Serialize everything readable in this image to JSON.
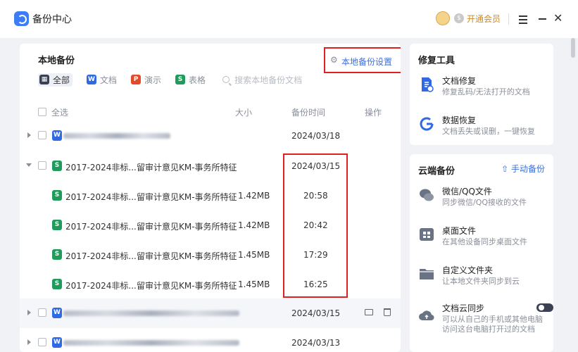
{
  "app": {
    "title": "备份中心",
    "vip_label": "开通会员"
  },
  "left": {
    "title": "本地备份",
    "settings_label": "本地备份设置",
    "filters": [
      {
        "label": "全部",
        "icon": "grid-icon"
      },
      {
        "label": "文档",
        "icon": "W"
      },
      {
        "label": "演示",
        "icon": "P"
      },
      {
        "label": "表格",
        "icon": "S"
      }
    ],
    "search_placeholder": "搜索本地备份文档",
    "headers": {
      "select_all": "全选",
      "size": "大小",
      "time": "备份时间",
      "action": "操作"
    },
    "rows": [
      {
        "type": "group",
        "file_icon": "W",
        "name": "",
        "size": "",
        "time": "2024/03/18",
        "expanded": false
      },
      {
        "type": "group",
        "file_icon": "S",
        "name": "2017-2024非标...",
        "desc": "留审计意见KM-事务所特征",
        "size": "",
        "time": "2024/03/15",
        "expanded": true
      },
      {
        "type": "child",
        "file_icon": "S",
        "name": "2017-2024非标...",
        "desc": "留审计意见KM-事务所特征",
        "size": "1.42MB",
        "time": "20:58"
      },
      {
        "type": "child",
        "file_icon": "S",
        "name": "2017-2024非标...",
        "desc": "留审计意见KM-事务所特征",
        "size": "1.42MB",
        "time": "20:42"
      },
      {
        "type": "child",
        "file_icon": "S",
        "name": "2017-2024非标...",
        "desc": "留审计意见KM-事务所特征",
        "size": "1.45MB",
        "time": "17:29"
      },
      {
        "type": "child",
        "file_icon": "S",
        "name": "2017-2024非标...",
        "desc": "留审计意见KM-事务所特征",
        "size": "1.45MB",
        "time": "16:25"
      },
      {
        "type": "group",
        "file_icon": "W",
        "name": "",
        "size": "",
        "time": "2024/03/15",
        "expanded": false
      },
      {
        "type": "group",
        "file_icon": "W",
        "name": "",
        "size": "",
        "time": "2024/03/13",
        "expanded": false
      }
    ]
  },
  "repair": {
    "title": "修复工具",
    "items": [
      {
        "title": "文档修复",
        "desc": "修复乱码/无法打开的文档",
        "icon": "doc-repair-icon"
      },
      {
        "title": "数据恢复",
        "desc": "文档丢失或误删，一键恢复",
        "icon": "data-recovery-icon"
      }
    ]
  },
  "cloud": {
    "title": "云端备份",
    "action_label": "手动备份",
    "items": [
      {
        "title": "微信/QQ文件",
        "desc": "同步微信/QQ接收的文件",
        "icon": "wechat-qq-icon"
      },
      {
        "title": "桌面文件",
        "desc": "在其他设备同步桌面文件",
        "icon": "desktop-icon"
      },
      {
        "title": "自定义文件夹",
        "desc": "让本地文件夹同步到云",
        "icon": "folder-icon"
      },
      {
        "title": "文档云同步",
        "desc": "可以从自己的手机或其他电脑",
        "desc2": "访问这台电脑打开过的文档",
        "icon": "cloud-sync-icon",
        "toggle_on": true
      }
    ]
  }
}
